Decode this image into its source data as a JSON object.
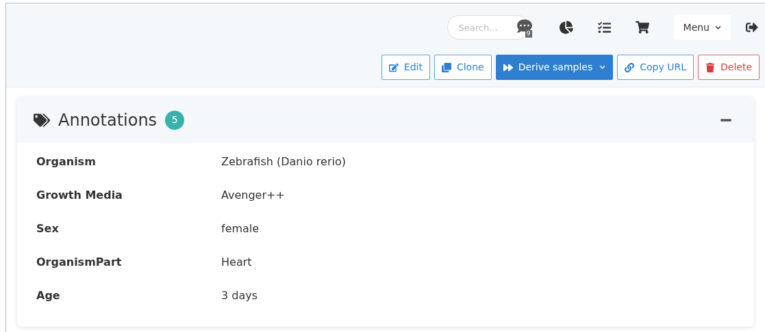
{
  "navbar": {
    "search": {
      "placeholder": "Search..."
    },
    "chat_badge": "9",
    "menu": "Menu"
  },
  "actions": [
    {
      "label": "Edit",
      "kind": "outline",
      "dropdown": false
    },
    {
      "label": "Clone",
      "kind": "outline",
      "dropdown": false
    },
    {
      "label": "Derive samples",
      "kind": "primary",
      "dropdown": true
    },
    {
      "label": "Copy URL",
      "kind": "outline",
      "dropdown": false
    },
    {
      "label": "Delete",
      "kind": "danger",
      "dropdown": false
    }
  ],
  "annotations": {
    "title": "Annotations",
    "count": "5",
    "expanded": true,
    "rows": [
      {
        "key": "Organism",
        "value": "Zebrafish (Danio rerio)"
      },
      {
        "key": "Growth Media",
        "value": "Avenger++"
      },
      {
        "key": "Sex",
        "value": "female"
      },
      {
        "key": "OrganismPart",
        "value": "Heart"
      },
      {
        "key": "Age",
        "value": "3 days"
      }
    ]
  }
}
